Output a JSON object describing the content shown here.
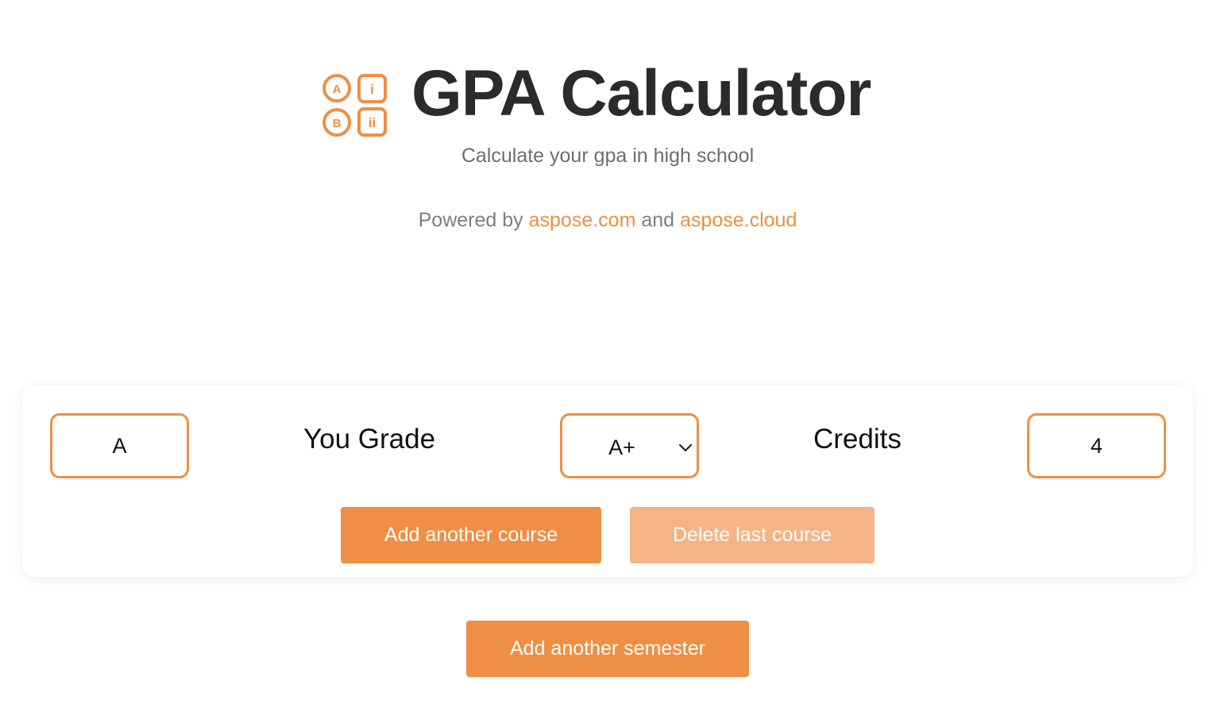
{
  "header": {
    "title": "GPA Calculator",
    "subtitle": "Calculate your gpa in high school",
    "powered_prefix": "Powered by",
    "powered_link1": "aspose.com",
    "powered_and": "and",
    "powered_link2": "aspose.cloud",
    "logo_letters": {
      "a": "A",
      "b": "B",
      "i": "i",
      "ii": "ii"
    }
  },
  "semester": {
    "course_value": "A",
    "grade_label": "You Grade",
    "grade_selected": "A+",
    "credits_label": "Credits",
    "credits_value": "4",
    "add_course_label": "Add another course",
    "delete_course_label": "Delete last course"
  },
  "add_semester_label": "Add another semester",
  "icons": {
    "logo": "abc-grades-icon",
    "select": "chevron-down-icon"
  },
  "colors": {
    "accent": "#ee8f45",
    "accent_light": "#f4b486",
    "title": "#2b2b2b",
    "muted": "#6e6e6e"
  }
}
